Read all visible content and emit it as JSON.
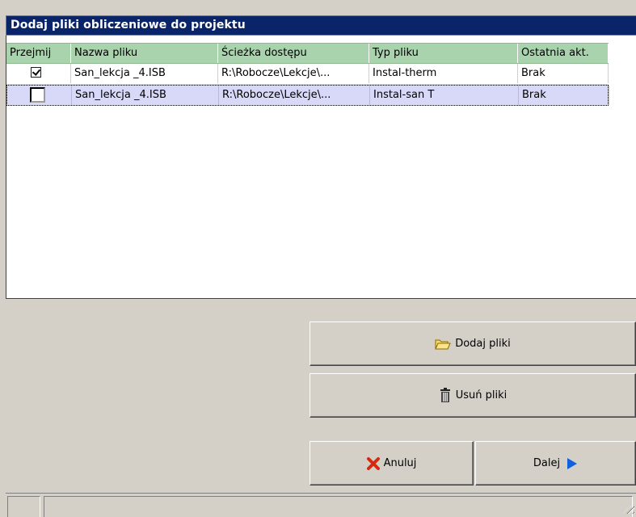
{
  "title": "Dodaj pliki obliczeniowe do projektu",
  "table": {
    "columns": [
      "Przejmij",
      "Nazwa pliku",
      "Ścieżka dostępu",
      "Typ pliku",
      "Ostatnia akt."
    ],
    "rows": [
      {
        "checked": true,
        "name": "San_lekcja _4.ISB",
        "path": "R:\\Robocze\\Lekcje\\...",
        "type": "Instal-therm",
        "last": "Brak"
      },
      {
        "checked": false,
        "name": "San_lekcja _4.ISB",
        "path": "R:\\Robocze\\Lekcje\\...",
        "type": "Instal-san T",
        "last": "Brak"
      }
    ]
  },
  "buttons": {
    "add": "Dodaj pliki",
    "remove": "Usuń pliki",
    "cancel": "Anuluj",
    "next": "Dalej"
  },
  "icons": {
    "add": "folder-open-icon",
    "remove": "trash-icon",
    "cancel": "red-x-icon",
    "next": "play-arrow-icon"
  },
  "colors": {
    "title_bg": "#0a246a",
    "header_bg": "#a9d3ad",
    "selected_row_bg": "#d8d8f8",
    "window_bg": "#d4d0c8",
    "arrow": "#1060e0",
    "cancel_x": "#d42a10"
  }
}
